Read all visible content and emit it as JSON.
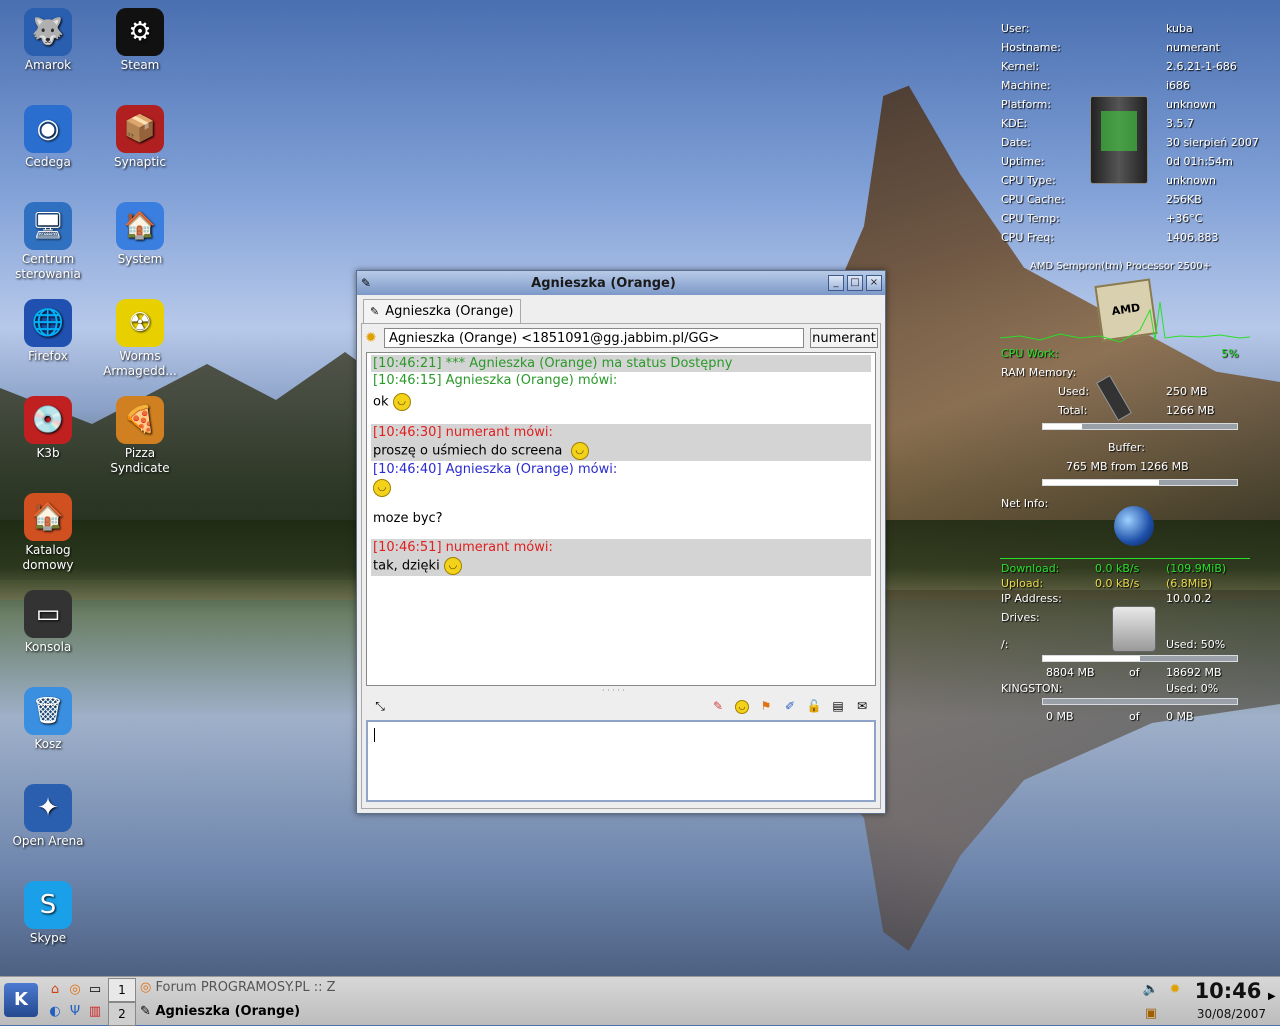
{
  "desktop": {
    "icons": [
      {
        "label": "Amarok",
        "glyph": "🐺"
      },
      {
        "label": "Steam",
        "glyph": "⚙"
      },
      {
        "label": "Cedega",
        "glyph": "◉"
      },
      {
        "label": "Synaptic",
        "glyph": "📦"
      },
      {
        "label": "Centrum sterowania",
        "glyph": "🖥"
      },
      {
        "label": "System",
        "glyph": "🏠"
      },
      {
        "label": "Firefox",
        "glyph": "🌐"
      },
      {
        "label": "Worms Armagedd...",
        "glyph": "☢"
      },
      {
        "label": "K3b",
        "glyph": "💿"
      },
      {
        "label": "Pizza Syndicate",
        "glyph": "🍕"
      },
      {
        "label": "Katalog domowy",
        "glyph": "🏠"
      },
      {
        "label": "Konsola",
        "glyph": "▭"
      },
      {
        "label": "Kosz",
        "glyph": "🗑"
      },
      {
        "label": "Open Arena",
        "glyph": "✦"
      },
      {
        "label": "Skype",
        "glyph": "S"
      }
    ]
  },
  "sysinfo": {
    "rows": [
      {
        "k": "User:",
        "v": "kuba"
      },
      {
        "k": "Hostname:",
        "v": "numerant"
      },
      {
        "k": "Kernel:",
        "v": "2.6.21-1-686"
      },
      {
        "k": "Machine:",
        "v": "i686"
      },
      {
        "k": "Platform:",
        "v": "unknown"
      },
      {
        "k": "KDE:",
        "v": "3.5.7"
      },
      {
        "k": "Date:",
        "v": "30 sierpień 2007"
      },
      {
        "k": "Uptime:",
        "v": "0d 01h:54m"
      },
      {
        "k": "CPU Type:",
        "v": "unknown"
      },
      {
        "k": "CPU Cache:",
        "v": "256KB"
      },
      {
        "k": "CPU Temp:",
        "v": "+36°C"
      },
      {
        "k": "CPU Freq:",
        "v": "1406.883"
      }
    ],
    "processor": "AMD Sempron(tm) Processor 2500+",
    "cpu_work_label": "CPU Work:",
    "cpu_work_value": "5%",
    "ram_label": "RAM Memory:",
    "ram_used_label": "Used:",
    "ram_used": "250 MB",
    "ram_total_label": "Total:",
    "ram_total": "1266 MB",
    "ram_fraction": 0.2,
    "buffer_label": "Buffer:",
    "buffer_value": "765 MB from 1266 MB",
    "buffer_fraction": 0.6,
    "net_label": "Net Info:",
    "download_label": "Download:",
    "download_rate": "0.0 kB/s",
    "download_total": "(109.9MiB)",
    "upload_label": "Upload:",
    "upload_rate": "0.0 kB/s",
    "upload_total": "(6.8MiB)",
    "ip_label": "IP Address:",
    "ip_value": "10.0.0.2",
    "drives_label": "Drives:",
    "root_label": "/:",
    "root_used": "Used: 50%",
    "root_fraction": 0.5,
    "root_free": "8804 MB",
    "of1": "of",
    "root_total": "18692 MB",
    "kingston_label": "KINGSTON:",
    "kingston_used": "Used: 0%",
    "kingston_free": "0 MB",
    "of2": "of",
    "kingston_total": "0 MB"
  },
  "chat": {
    "title": "Agnieszka (Orange)",
    "tab_label": "Agnieszka (Orange)",
    "contact": "Agnieszka (Orange) <1851091@gg.jabbim.pl/GG>",
    "nick_button": "numerant",
    "messages": [
      {
        "line": "[10:46:21] *** Agnieszka (Orange) ma status Dostępny"
      },
      {
        "line": "[10:46:15] Agnieszka (Orange) mówi:"
      },
      {
        "line": "ok"
      },
      {
        "line": "[10:46:30] numerant mówi:"
      },
      {
        "line": "proszę o uśmiech do screena"
      },
      {
        "line": "[10:46:40] Agnieszka (Orange) mówi:"
      },
      {
        "line": "moze byc?"
      },
      {
        "line": "[10:46:51] numerant mówi:"
      },
      {
        "line": "tak, dzięki"
      }
    ],
    "grip": "· · · · ·"
  },
  "taskbar": {
    "kmenu": "K",
    "pager_1": "1",
    "pager_2": "2",
    "task_1": "Forum PROGRAMOSY.PL :: Z",
    "task_2": "Agnieszka (Orange)",
    "clock": "10:46",
    "date": "30/08/2007"
  }
}
